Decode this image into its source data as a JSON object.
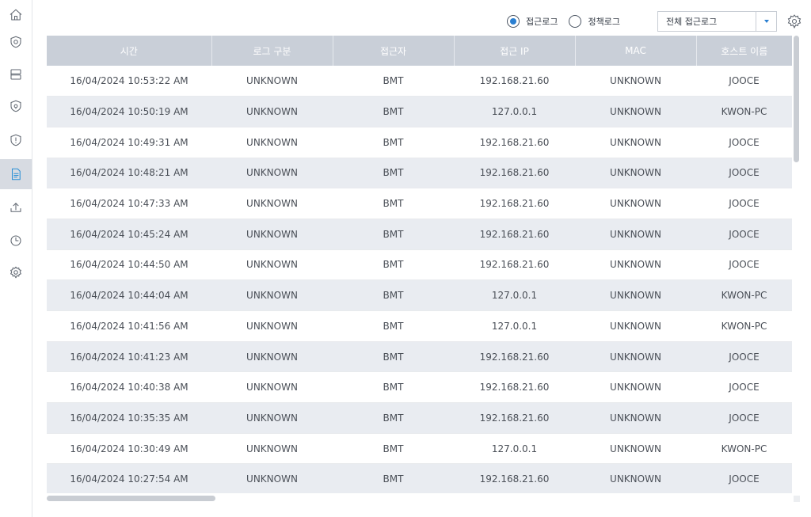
{
  "sidebar": {
    "items": [
      {
        "icon": "home-icon",
        "active": false
      },
      {
        "icon": "shield-gear-icon",
        "active": false
      },
      {
        "icon": "server-icon",
        "active": false
      },
      {
        "icon": "shield-lock-icon",
        "active": false
      },
      {
        "icon": "shield-alert-icon",
        "active": false
      },
      {
        "icon": "document-icon",
        "active": true
      },
      {
        "icon": "upload-icon",
        "active": false
      },
      {
        "icon": "clock-icon",
        "active": false
      },
      {
        "icon": "gear-icon",
        "active": false
      }
    ],
    "accent_color": "#2a8fd6"
  },
  "toolbar": {
    "radio_access_label": "접근로그",
    "radio_policy_label": "정책로그",
    "selected_radio": "access",
    "select_value": "전체 접근로그",
    "settings_icon": "gear-icon"
  },
  "table": {
    "columns": [
      "시간",
      "로그 구분",
      "접근자",
      "접근 IP",
      "MAC",
      "호스트 이름"
    ],
    "rows": [
      [
        "16/04/2024 10:53:22 AM",
        "UNKNOWN",
        "BMT",
        "192.168.21.60",
        "UNKNOWN",
        "JOOCE"
      ],
      [
        "16/04/2024 10:50:19 AM",
        "UNKNOWN",
        "BMT",
        "127.0.0.1",
        "UNKNOWN",
        "KWON-PC"
      ],
      [
        "16/04/2024 10:49:31 AM",
        "UNKNOWN",
        "BMT",
        "192.168.21.60",
        "UNKNOWN",
        "JOOCE"
      ],
      [
        "16/04/2024 10:48:21 AM",
        "UNKNOWN",
        "BMT",
        "192.168.21.60",
        "UNKNOWN",
        "JOOCE"
      ],
      [
        "16/04/2024 10:47:33 AM",
        "UNKNOWN",
        "BMT",
        "192.168.21.60",
        "UNKNOWN",
        "JOOCE"
      ],
      [
        "16/04/2024 10:45:24 AM",
        "UNKNOWN",
        "BMT",
        "192.168.21.60",
        "UNKNOWN",
        "JOOCE"
      ],
      [
        "16/04/2024 10:44:50 AM",
        "UNKNOWN",
        "BMT",
        "192.168.21.60",
        "UNKNOWN",
        "JOOCE"
      ],
      [
        "16/04/2024 10:44:04 AM",
        "UNKNOWN",
        "BMT",
        "127.0.0.1",
        "UNKNOWN",
        "KWON-PC"
      ],
      [
        "16/04/2024 10:41:56 AM",
        "UNKNOWN",
        "BMT",
        "127.0.0.1",
        "UNKNOWN",
        "KWON-PC"
      ],
      [
        "16/04/2024 10:41:23 AM",
        "UNKNOWN",
        "BMT",
        "192.168.21.60",
        "UNKNOWN",
        "JOOCE"
      ],
      [
        "16/04/2024 10:40:38 AM",
        "UNKNOWN",
        "BMT",
        "192.168.21.60",
        "UNKNOWN",
        "JOOCE"
      ],
      [
        "16/04/2024 10:35:35 AM",
        "UNKNOWN",
        "BMT",
        "192.168.21.60",
        "UNKNOWN",
        "JOOCE"
      ],
      [
        "16/04/2024 10:30:49 AM",
        "UNKNOWN",
        "BMT",
        "127.0.0.1",
        "UNKNOWN",
        "KWON-PC"
      ],
      [
        "16/04/2024 10:27:54 AM",
        "UNKNOWN",
        "BMT",
        "192.168.21.60",
        "UNKNOWN",
        "JOOCE"
      ]
    ]
  }
}
